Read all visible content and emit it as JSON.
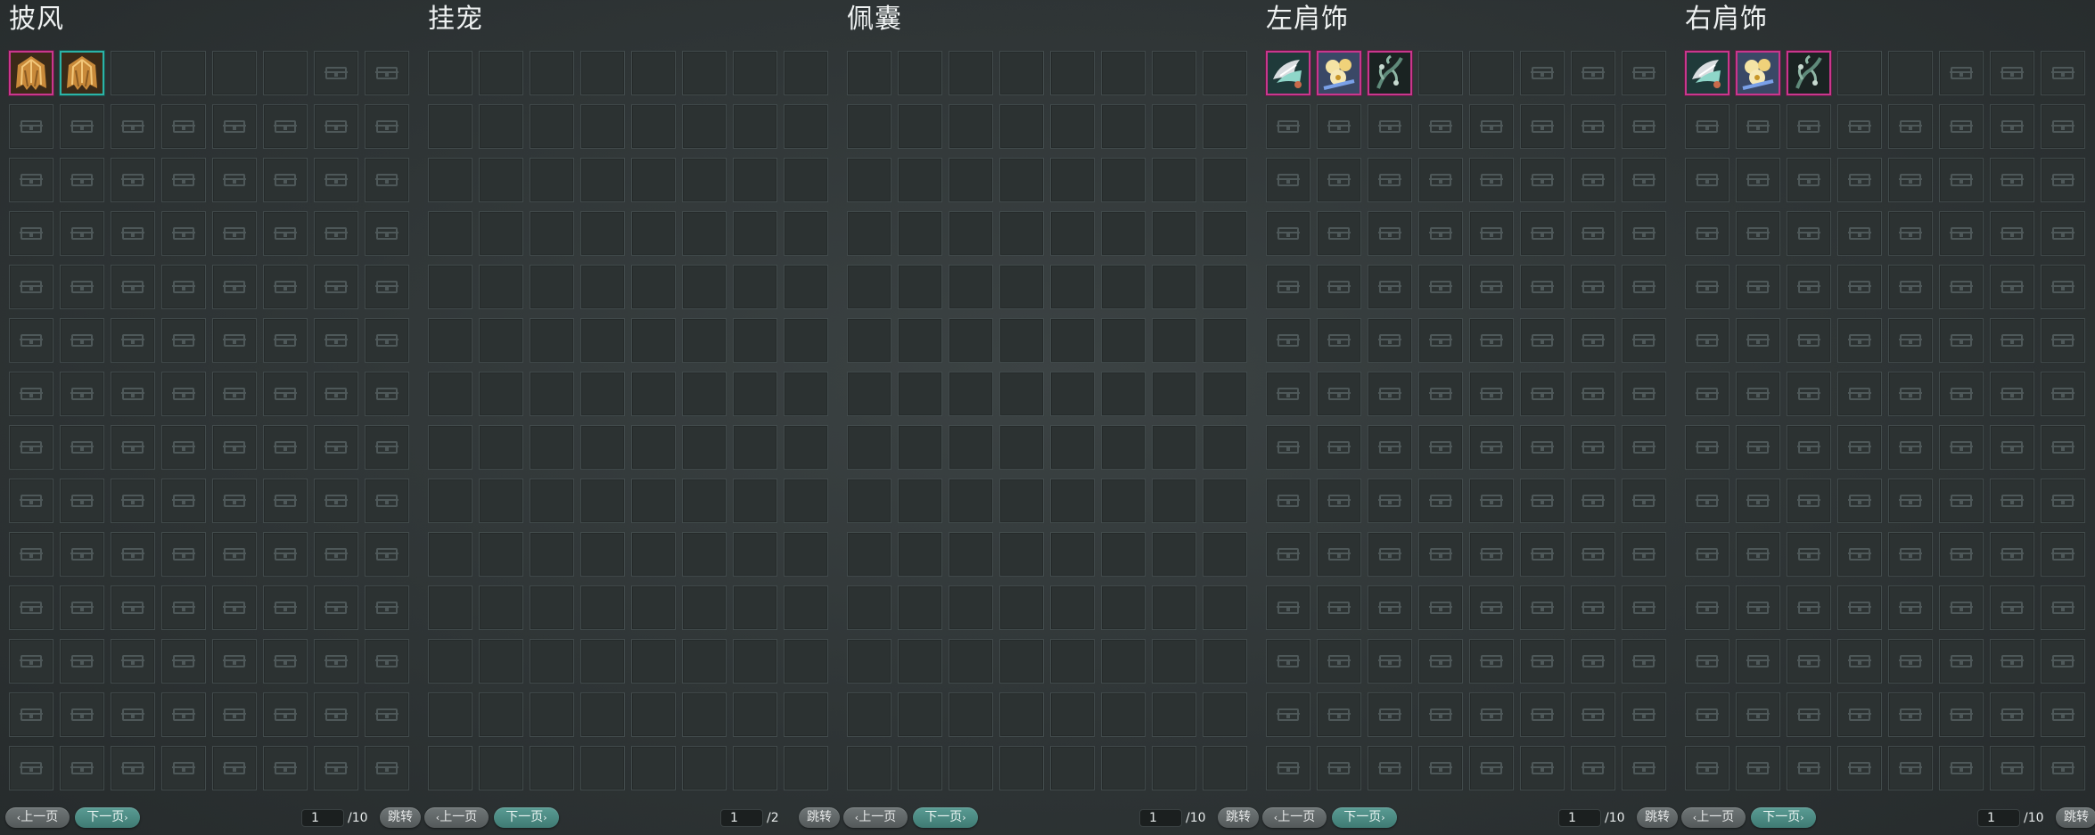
{
  "pager_labels": {
    "prev": "上一页",
    "next": "下一页",
    "jump": "跳转"
  },
  "colors": {
    "filled_border_magenta": "#c9378d",
    "filled_border_teal": "#2bb3a7",
    "next_button": "#4a8a82"
  },
  "panels": [
    {
      "title": "披风",
      "page": "1",
      "total": "/10",
      "slot_style": "locked",
      "items": [
        {
          "icon": "golden-cape-icon",
          "border": "magenta"
        },
        {
          "icon": "golden-cape-icon",
          "border": "teal"
        }
      ],
      "empty_unlocked_slots": 6
    },
    {
      "title": "挂宠",
      "page": "1",
      "total": "/2",
      "slot_style": "empty",
      "items": [],
      "empty_unlocked_slots": 0
    },
    {
      "title": "佩囊",
      "page": "1",
      "total": "/10",
      "slot_style": "empty",
      "items": [],
      "empty_unlocked_slots": 0
    },
    {
      "title": "左肩饰",
      "page": "1",
      "total": "/10",
      "slot_style": "locked",
      "items": [
        {
          "icon": "silver-shoulder-icon",
          "border": "magenta"
        },
        {
          "icon": "gold-flower-shoulder-icon",
          "border": "magenta"
        },
        {
          "icon": "dark-vine-shoulder-icon",
          "border": "magenta"
        }
      ],
      "empty_unlocked_slots": 5
    },
    {
      "title": "右肩饰",
      "page": "1",
      "total": "/10",
      "slot_style": "locked",
      "items": [
        {
          "icon": "silver-shoulder-icon",
          "border": "magenta"
        },
        {
          "icon": "gold-flower-shoulder-icon",
          "border": "magenta"
        },
        {
          "icon": "dark-vine-shoulder-icon",
          "border": "magenta"
        }
      ],
      "empty_unlocked_slots": 5
    }
  ]
}
